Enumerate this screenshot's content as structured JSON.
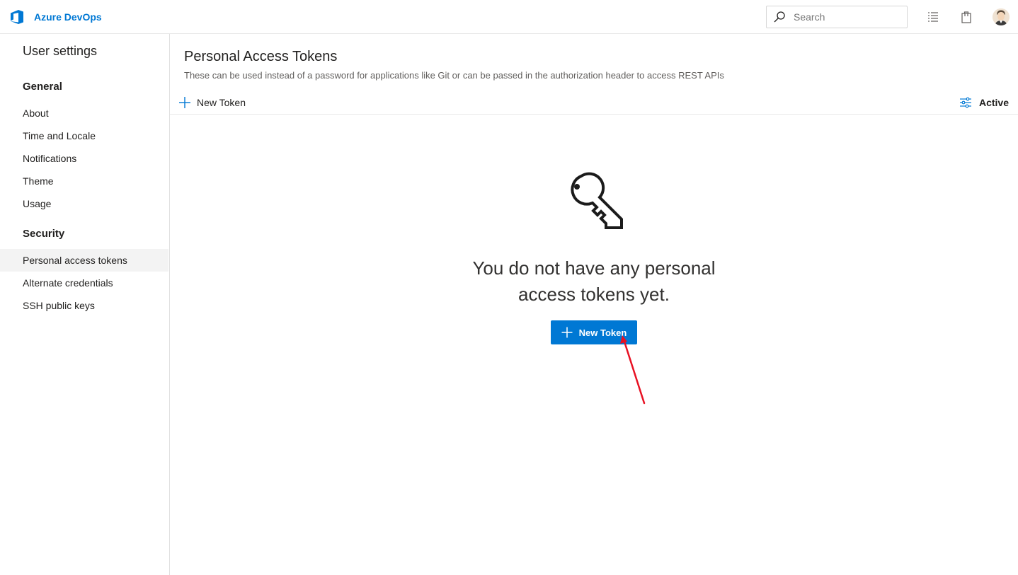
{
  "topbar": {
    "brand_name": "Azure DevOps",
    "search_placeholder": "Search",
    "icons": [
      "azure-devops-logo",
      "search-icon",
      "work-items-icon",
      "marketplace-bag-icon",
      "user-avatar"
    ]
  },
  "sidebar": {
    "title": "User settings",
    "sections": [
      {
        "heading": "General",
        "items": [
          "About",
          "Time and Locale",
          "Notifications",
          "Theme",
          "Usage"
        ]
      },
      {
        "heading": "Security",
        "items": [
          "Personal access tokens",
          "Alternate credentials",
          "SSH public keys"
        ]
      }
    ],
    "selected_item": "Personal access tokens"
  },
  "main": {
    "title": "Personal Access Tokens",
    "subtitle": "These can be used instead of a password for applications like Git or can be passed in the authorization header to access REST APIs",
    "command_bar": {
      "new_token_label": "New Token",
      "filter_label": "Active"
    },
    "empty_state": {
      "icon": "key-icon",
      "message_line1": "You do not have any personal",
      "message_line2": "access tokens yet.",
      "button_label": "New Token"
    }
  },
  "colors": {
    "accent": "#0078d4",
    "annotation": "#e81123"
  }
}
